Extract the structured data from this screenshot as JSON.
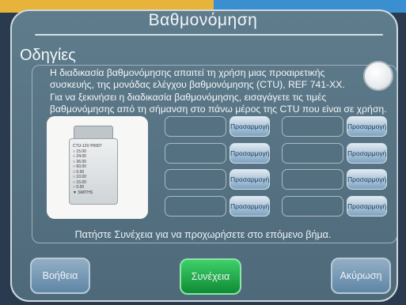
{
  "window": {
    "title": "Βαθμονόμηση"
  },
  "section": {
    "heading": "Οδηγίες"
  },
  "instructions": {
    "lines": [
      "Η διαδικασία βαθμονόμησης απαιτεί τη χρήση μιας προαιρετικής",
      "συσκευής, της μονάδας ελέγχου βαθμονόμησης (CTU), REF 741-XX.",
      "Για να ξεκινήσει η διαδικασία βαθμονόμησης, εισαγάγετε τις τιμές",
      "βαθμονόμησης από τη σήμανση στο πάνω μέρος της CTU που είναι σε χρήση."
    ]
  },
  "device_label_lines": [
    "CTU-12V P0007",
    "○ 15.00",
    "○ 24.00",
    "○ 36.00",
    "○ 60.00",
    "○ 0.00",
    "○ 10.00",
    "○ 15.00",
    "○ 0.00",
    "▼ SMITHS"
  ],
  "calibration": {
    "entries": [
      {
        "value": "",
        "adjust_label": "Προσαρμογή"
      },
      {
        "value": "",
        "adjust_label": "Προσαρμογή"
      },
      {
        "value": "",
        "adjust_label": "Προσαρμογή"
      },
      {
        "value": "",
        "adjust_label": "Προσαρμογή"
      },
      {
        "value": "",
        "adjust_label": "Προσαρμογή"
      },
      {
        "value": "",
        "adjust_label": "Προσαρμογή"
      },
      {
        "value": "",
        "adjust_label": "Προσαρμογή"
      },
      {
        "value": "",
        "adjust_label": "Προσαρμογή"
      }
    ]
  },
  "continue_message": "Πατήστε Συνέχεια για να προχωρήσετε στο επόμενο βήμα.",
  "footer": {
    "help_label": "Βοήθεια",
    "continue_label": "Συνέχεια",
    "cancel_label": "Ακύρωση"
  },
  "colors": {
    "frame": "#5f7c8c",
    "accent_continue": "#1fae4c",
    "button_blue": "#6f93b1"
  }
}
